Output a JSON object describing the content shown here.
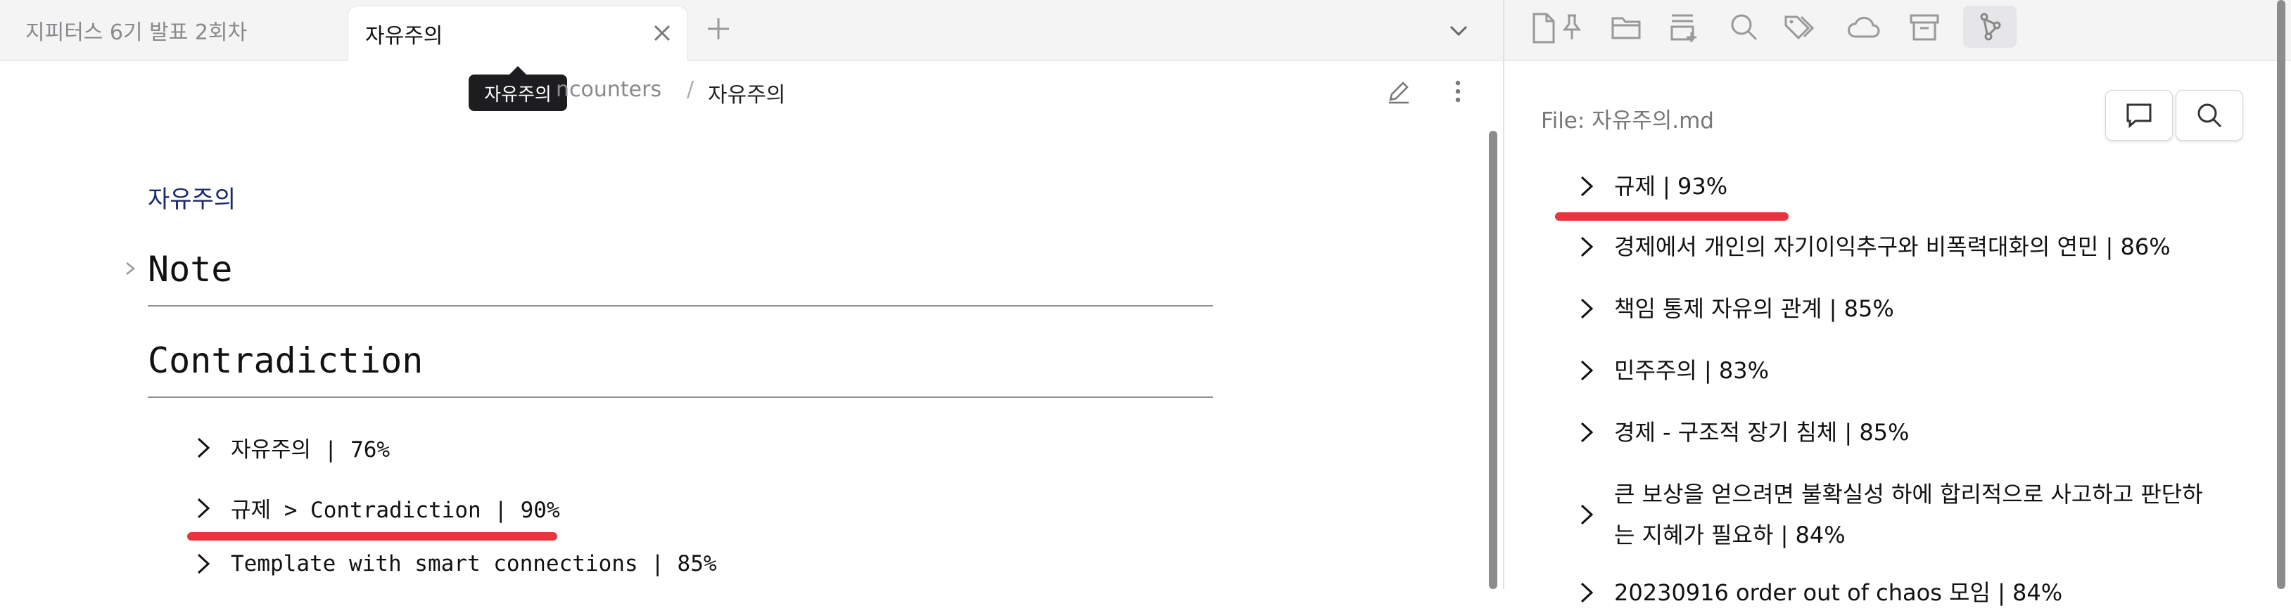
{
  "tabs": [
    {
      "label": "지피터스 6기 발표 2회차"
    },
    {
      "label": "자유주의"
    }
  ],
  "tooltip": "자유주의",
  "breadcrumb": {
    "parent": "ncounters",
    "separator": "/",
    "current": "자유주의"
  },
  "editor": {
    "note_link": "자유주의",
    "heading_note": "Note",
    "heading_contradiction": "Contradiction",
    "results": [
      {
        "label": "자유주의 | 76%"
      },
      {
        "label": "규제 > Contradiction | 90%"
      },
      {
        "label": "Template with smart connections | 85%"
      }
    ]
  },
  "side_panel": {
    "file_label": "File: 자유주의.md",
    "results": [
      {
        "label": "규제 | 93%"
      },
      {
        "label": "경제에서 개인의 자기이익추구와 비폭력대화의 연민 | 86%"
      },
      {
        "label": "책임 통제 자유의 관계 | 85%"
      },
      {
        "label": "민주주의 | 83%"
      },
      {
        "label": "경제 - 구조적 장기 침체 | 85%"
      },
      {
        "line1": "큰 보상을 얻으려면 불확실성 하에 합리적으로 사고하고 판단하",
        "line2": "는 지혜가 필요하 | 84%"
      },
      {
        "label": "20230916 order out of chaos 모임 | 84%"
      }
    ]
  },
  "colors": {
    "highlight": "#e8343f",
    "link": "#1c2a6b",
    "active_toolbar": "#e6e6e8"
  },
  "icons": [
    "close-icon",
    "plus-icon",
    "chevron-down-icon",
    "file-icon",
    "pin-icon",
    "folder-icon",
    "stack-add-icon",
    "search-icon",
    "tags-icon",
    "cloud-icon",
    "archive-icon",
    "graph-icon",
    "pencil-icon",
    "more-icon",
    "comment-icon"
  ]
}
